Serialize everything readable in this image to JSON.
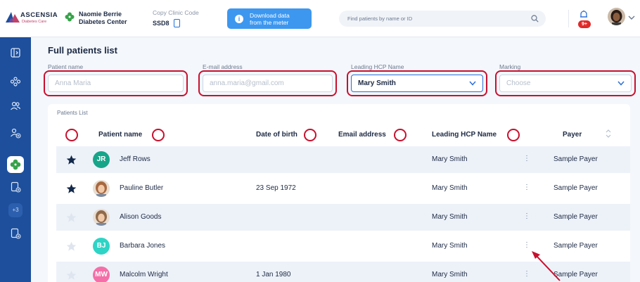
{
  "header": {
    "brand": "ASCENSIA",
    "brand_sub": "Diabetes Care",
    "user_name": "Naomie Berrie",
    "clinic_name": "Diabetes Center",
    "copy_code_label": "Copy Clinic Code",
    "clinic_code": "SSD8",
    "download_line1": "Download data",
    "download_line2": "from the meter",
    "search_placeholder": "Find patients by name or ID",
    "notifications_badge": "9+"
  },
  "page": {
    "title": "Full patients list"
  },
  "filters": {
    "patient_name_label": "Patient name",
    "patient_name_placeholder": "Anna Maria",
    "email_label": "E-mail address",
    "email_placeholder": "anna.maria@gmail.com",
    "hcp_label": "Leading HCP Name",
    "hcp_value": "Mary Smith",
    "marking_label": "Marking",
    "marking_placeholder": "Choose"
  },
  "sidebar": {
    "more_count": "+3"
  },
  "table": {
    "panel_title": "Patients List",
    "columns": [
      "Patient name",
      "Date of birth",
      "Email address",
      "Leading HCP Name",
      "Payer"
    ],
    "rows": [
      {
        "starred": true,
        "initials": "JR",
        "avatar_type": "initials",
        "avatar_color": "#17a589",
        "name": "Jeff Rows",
        "dob": "",
        "email": "",
        "hcp": "Mary Smith",
        "payer": "Sample Payer"
      },
      {
        "starred": true,
        "initials": "",
        "avatar_type": "photo",
        "avatar_color": "#a7683f",
        "name": "Pauline Butler",
        "dob": "23 Sep 1972",
        "email": "",
        "hcp": "Mary Smith",
        "payer": "Sample Payer"
      },
      {
        "starred": false,
        "initials": "",
        "avatar_type": "photo",
        "avatar_color": "#8f6a4a",
        "name": "Alison Goods",
        "dob": "",
        "email": "",
        "hcp": "Mary Smith",
        "payer": "Sample Payer"
      },
      {
        "starred": false,
        "initials": "BJ",
        "avatar_type": "initials",
        "avatar_color": "#2ed4c6",
        "name": "Barbara Jones",
        "dob": "",
        "email": "",
        "hcp": "Mary Smith",
        "payer": "Sample Payer"
      },
      {
        "starred": false,
        "initials": "MW",
        "avatar_type": "initials",
        "avatar_color": "#f46fa8",
        "name": "Malcolm Wright",
        "dob": "1 Jan 1980",
        "email": "",
        "hcp": "Mary Smith",
        "payer": "Sample Payer"
      }
    ]
  },
  "colors": {
    "sidebar": "#1d4f9c",
    "accent_blue": "#3d97ef",
    "annotation_red": "#c8102e",
    "star_filled": "#13294b",
    "star_empty": "#dfe5ee",
    "badge_red": "#e02a2a"
  },
  "icons": [
    "logo-triangle",
    "clover-icon",
    "copy-icon",
    "info-icon",
    "search-icon",
    "bell-icon",
    "chevron-down-icon",
    "exit-icon",
    "group-icon",
    "users-icon",
    "add-user-icon",
    "clover-icon",
    "add-document-icon",
    "star-icon",
    "kebab-icon",
    "sort-icon"
  ]
}
